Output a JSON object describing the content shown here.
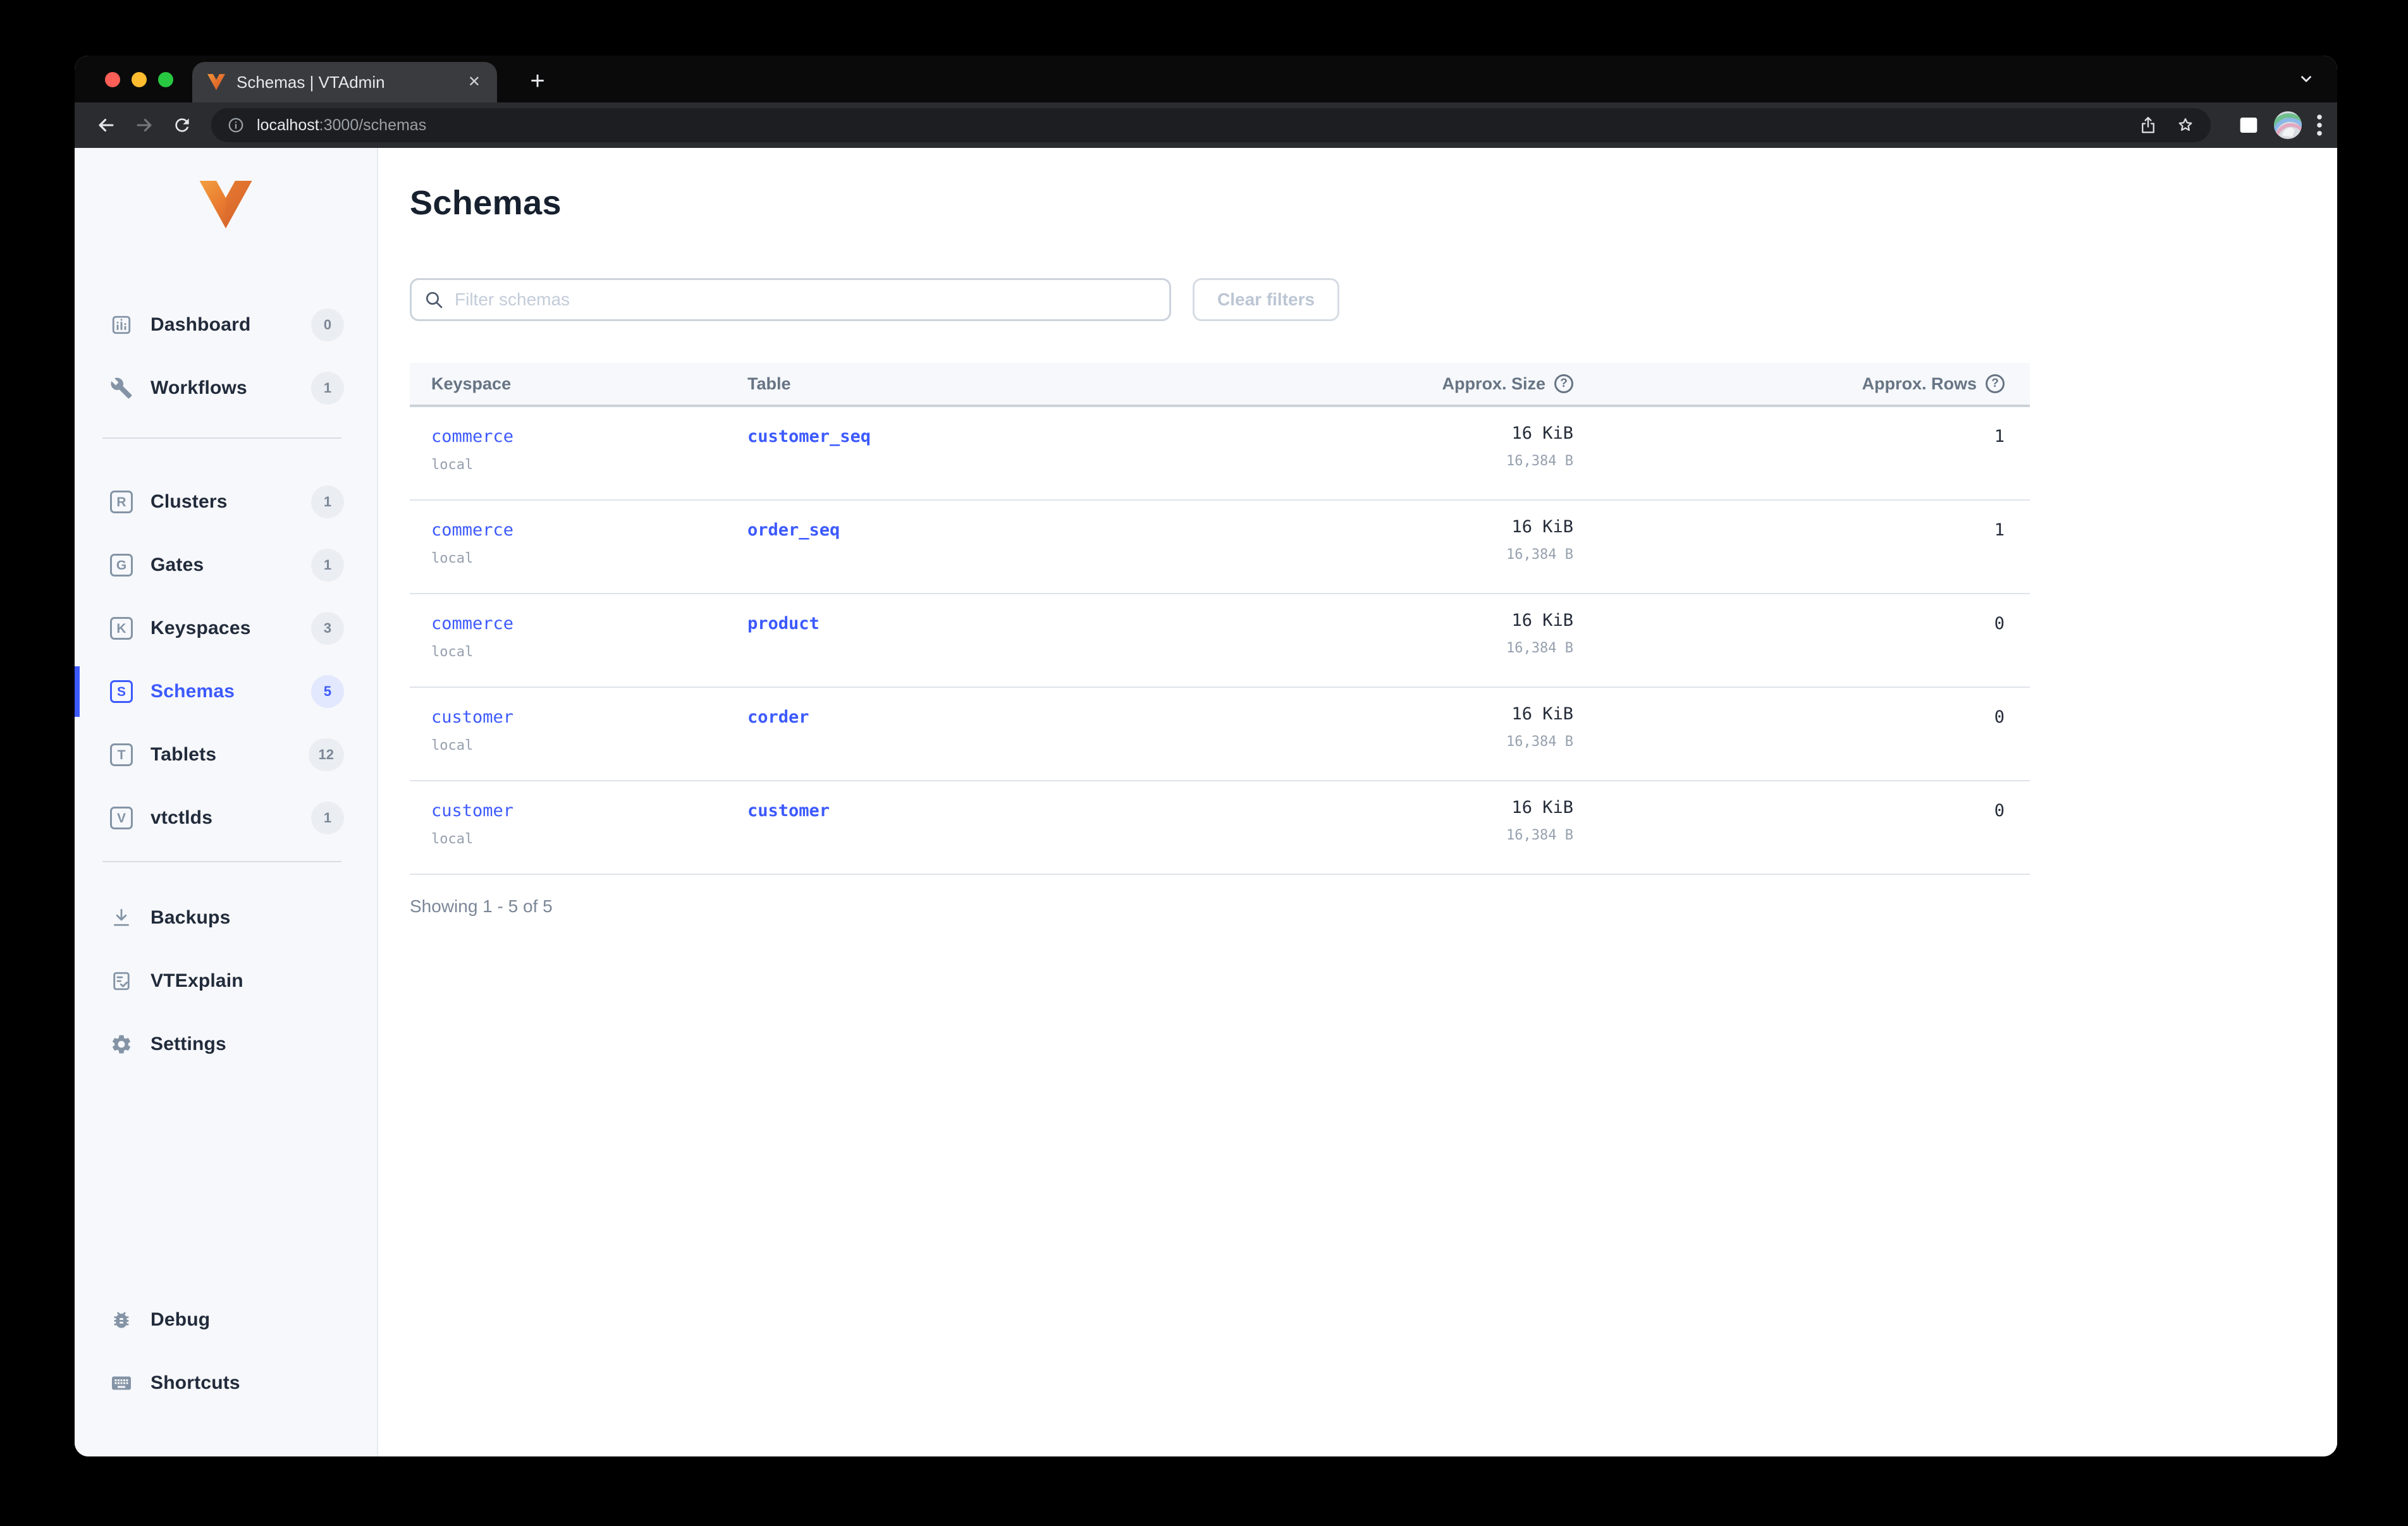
{
  "browser": {
    "tab_title": "Schemas | VTAdmin",
    "close_glyph": "✕",
    "new_tab_glyph": "+",
    "url_host": "localhost",
    "url_rest": ":3000/schemas"
  },
  "sidebar": {
    "items": [
      {
        "label": "Dashboard",
        "badge": "0",
        "icon": "dashboard-icon"
      },
      {
        "label": "Workflows",
        "badge": "1",
        "icon": "workflows-icon"
      },
      {
        "label": "Clusters",
        "badge": "1",
        "icon_letter": "R"
      },
      {
        "label": "Gates",
        "badge": "1",
        "icon_letter": "G"
      },
      {
        "label": "Keyspaces",
        "badge": "3",
        "icon_letter": "K"
      },
      {
        "label": "Schemas",
        "badge": "5",
        "icon_letter": "S",
        "active": true
      },
      {
        "label": "Tablets",
        "badge": "12",
        "icon_letter": "T"
      },
      {
        "label": "vtctlds",
        "badge": "1",
        "icon_letter": "V"
      }
    ],
    "tools": [
      {
        "label": "Backups",
        "icon": "backups-icon"
      },
      {
        "label": "VTExplain",
        "icon": "vtexplain-icon"
      },
      {
        "label": "Settings",
        "icon": "settings-icon"
      }
    ],
    "footer": [
      {
        "label": "Debug",
        "icon": "debug-icon"
      },
      {
        "label": "Shortcuts",
        "icon": "shortcuts-icon"
      }
    ]
  },
  "main": {
    "title": "Schemas",
    "filter_placeholder": "Filter schemas",
    "clear_button_label": "Clear filters",
    "table": {
      "headers": [
        "Keyspace",
        "Table",
        "Approx. Size",
        "Approx. Rows"
      ],
      "help_glyph": "?",
      "rows": [
        {
          "keyspace": "commerce",
          "shard": "local",
          "table": "customer_seq",
          "size": "16 KiB",
          "size_bytes": "16,384 B",
          "approx_rows": "1"
        },
        {
          "keyspace": "commerce",
          "shard": "local",
          "table": "order_seq",
          "size": "16 KiB",
          "size_bytes": "16,384 B",
          "approx_rows": "1"
        },
        {
          "keyspace": "commerce",
          "shard": "local",
          "table": "product",
          "size": "16 KiB",
          "size_bytes": "16,384 B",
          "approx_rows": "0"
        },
        {
          "keyspace": "customer",
          "shard": "local",
          "table": "corder",
          "size": "16 KiB",
          "size_bytes": "16,384 B",
          "approx_rows": "0"
        },
        {
          "keyspace": "customer",
          "shard": "local",
          "table": "customer",
          "size": "16 KiB",
          "size_bytes": "16,384 B",
          "approx_rows": "0"
        }
      ]
    },
    "showing_text": "Showing 1 - 5 of 5"
  },
  "colors": {
    "accent": "#3d5afe",
    "link": "#3d5afe",
    "sidebar_bg": "#f7f8fb",
    "traffic_red": "#ff5f57",
    "traffic_yellow": "#febc2e",
    "traffic_green": "#28c840"
  }
}
